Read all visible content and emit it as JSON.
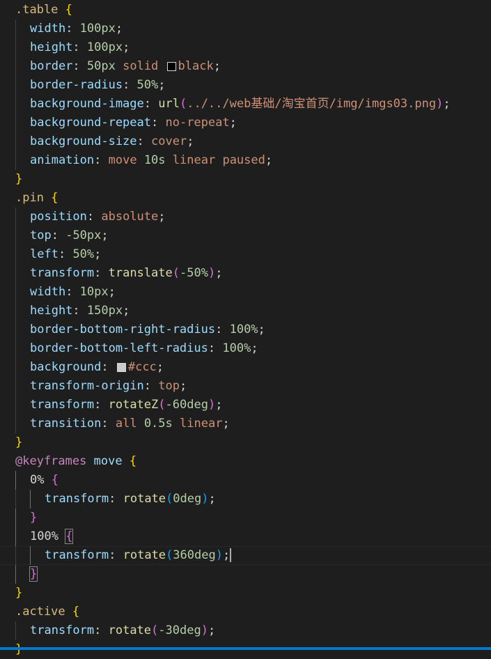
{
  "lines": [
    {
      "indent": 0,
      "tokens": [
        {
          "t": ".table",
          "c": "sel"
        },
        {
          "t": " "
        },
        {
          "t": "{",
          "c": "b1"
        }
      ]
    },
    {
      "indent": 1,
      "tokens": [
        {
          "t": "width",
          "c": "prop"
        },
        {
          "t": ": "
        },
        {
          "t": "100px",
          "c": "num"
        },
        {
          "t": ";"
        }
      ]
    },
    {
      "indent": 1,
      "tokens": [
        {
          "t": "height",
          "c": "prop"
        },
        {
          "t": ": "
        },
        {
          "t": "100px",
          "c": "num"
        },
        {
          "t": ";"
        }
      ]
    },
    {
      "indent": 1,
      "tokens": [
        {
          "t": "border",
          "c": "prop"
        },
        {
          "t": ": "
        },
        {
          "t": "50px",
          "c": "num"
        },
        {
          "t": " "
        },
        {
          "t": "solid",
          "c": "val"
        },
        {
          "t": " "
        },
        {
          "swatch": "#000000"
        },
        {
          "t": "black",
          "c": "val"
        },
        {
          "t": ";"
        }
      ]
    },
    {
      "indent": 1,
      "tokens": [
        {
          "t": "border-radius",
          "c": "prop"
        },
        {
          "t": ": "
        },
        {
          "t": "50%",
          "c": "num"
        },
        {
          "t": ";"
        }
      ]
    },
    {
      "indent": 1,
      "tokens": [
        {
          "t": "background-image",
          "c": "prop"
        },
        {
          "t": ": "
        },
        {
          "t": "url",
          "c": "fn"
        },
        {
          "t": "(",
          "c": "b2"
        },
        {
          "t": "../../web基础/淘宝首页/img/imgs03.png",
          "c": "val"
        },
        {
          "t": ")",
          "c": "b2"
        },
        {
          "t": ";"
        }
      ]
    },
    {
      "indent": 1,
      "tokens": [
        {
          "t": "background-repeat",
          "c": "prop"
        },
        {
          "t": ": "
        },
        {
          "t": "no-repeat",
          "c": "val"
        },
        {
          "t": ";"
        }
      ]
    },
    {
      "indent": 1,
      "tokens": [
        {
          "t": "background-size",
          "c": "prop"
        },
        {
          "t": ": "
        },
        {
          "t": "cover",
          "c": "val"
        },
        {
          "t": ";"
        }
      ]
    },
    {
      "indent": 1,
      "tokens": [
        {
          "t": "animation",
          "c": "prop"
        },
        {
          "t": ": "
        },
        {
          "t": "move",
          "c": "val"
        },
        {
          "t": " "
        },
        {
          "t": "10s",
          "c": "num"
        },
        {
          "t": " "
        },
        {
          "t": "linear",
          "c": "val"
        },
        {
          "t": " "
        },
        {
          "t": "paused",
          "c": "val"
        },
        {
          "t": ";"
        }
      ]
    },
    {
      "indent": 0,
      "tokens": [
        {
          "t": "}",
          "c": "b1"
        }
      ]
    },
    {
      "indent": 0,
      "tokens": [
        {
          "t": ".pin",
          "c": "sel"
        },
        {
          "t": " "
        },
        {
          "t": "{",
          "c": "b1"
        }
      ]
    },
    {
      "indent": 1,
      "tokens": [
        {
          "t": "position",
          "c": "prop"
        },
        {
          "t": ": "
        },
        {
          "t": "absolute",
          "c": "val"
        },
        {
          "t": ";"
        }
      ]
    },
    {
      "indent": 1,
      "tokens": [
        {
          "t": "top",
          "c": "prop"
        },
        {
          "t": ": "
        },
        {
          "t": "-50px",
          "c": "num"
        },
        {
          "t": ";"
        }
      ]
    },
    {
      "indent": 1,
      "tokens": [
        {
          "t": "left",
          "c": "prop"
        },
        {
          "t": ": "
        },
        {
          "t": "50%",
          "c": "num"
        },
        {
          "t": ";"
        }
      ]
    },
    {
      "indent": 1,
      "tokens": [
        {
          "t": "transform",
          "c": "prop"
        },
        {
          "t": ": "
        },
        {
          "t": "translate",
          "c": "fn"
        },
        {
          "t": "(",
          "c": "b2"
        },
        {
          "t": "-50%",
          "c": "num"
        },
        {
          "t": ")",
          "c": "b2"
        },
        {
          "t": ";"
        }
      ]
    },
    {
      "indent": 1,
      "tokens": [
        {
          "t": "width",
          "c": "prop"
        },
        {
          "t": ": "
        },
        {
          "t": "10px",
          "c": "num"
        },
        {
          "t": ";"
        }
      ]
    },
    {
      "indent": 1,
      "tokens": [
        {
          "t": "height",
          "c": "prop"
        },
        {
          "t": ": "
        },
        {
          "t": "150px",
          "c": "num"
        },
        {
          "t": ";"
        }
      ]
    },
    {
      "indent": 1,
      "tokens": [
        {
          "t": "border-bottom-right-radius",
          "c": "prop"
        },
        {
          "t": ": "
        },
        {
          "t": "100%",
          "c": "num"
        },
        {
          "t": ";"
        }
      ]
    },
    {
      "indent": 1,
      "tokens": [
        {
          "t": "border-bottom-left-radius",
          "c": "prop"
        },
        {
          "t": ": "
        },
        {
          "t": "100%",
          "c": "num"
        },
        {
          "t": ";"
        }
      ]
    },
    {
      "indent": 1,
      "tokens": [
        {
          "t": "background",
          "c": "prop"
        },
        {
          "t": ": "
        },
        {
          "swatch": "#cccccc"
        },
        {
          "t": "#ccc",
          "c": "val"
        },
        {
          "t": ";"
        }
      ]
    },
    {
      "indent": 1,
      "tokens": [
        {
          "t": "transform-origin",
          "c": "prop"
        },
        {
          "t": ": "
        },
        {
          "t": "top",
          "c": "val"
        },
        {
          "t": ";"
        }
      ]
    },
    {
      "indent": 1,
      "tokens": [
        {
          "t": "transform",
          "c": "prop"
        },
        {
          "t": ": "
        },
        {
          "t": "rotateZ",
          "c": "fn"
        },
        {
          "t": "(",
          "c": "b2"
        },
        {
          "t": "-60deg",
          "c": "num"
        },
        {
          "t": ")",
          "c": "b2"
        },
        {
          "t": ";"
        }
      ]
    },
    {
      "indent": 1,
      "tokens": [
        {
          "t": "transition",
          "c": "prop"
        },
        {
          "t": ": "
        },
        {
          "t": "all",
          "c": "val"
        },
        {
          "t": " "
        },
        {
          "t": "0.5s",
          "c": "num"
        },
        {
          "t": " "
        },
        {
          "t": "linear",
          "c": "val"
        },
        {
          "t": ";"
        }
      ]
    },
    {
      "indent": 0,
      "tokens": [
        {
          "t": "}",
          "c": "b1"
        }
      ]
    },
    {
      "indent": 0,
      "tokens": [
        {
          "t": "@keyframes",
          "c": "at"
        },
        {
          "t": " "
        },
        {
          "t": "move",
          "c": "prop"
        },
        {
          "t": " "
        },
        {
          "t": "{",
          "c": "b1"
        }
      ]
    },
    {
      "indent": 1,
      "tokens": [
        {
          "t": "0%",
          "c": "punc"
        },
        {
          "t": " "
        },
        {
          "t": "{",
          "c": "b2"
        }
      ]
    },
    {
      "indent": 2,
      "tokens": [
        {
          "t": "transform",
          "c": "prop"
        },
        {
          "t": ": "
        },
        {
          "t": "rotate",
          "c": "fn"
        },
        {
          "t": "(",
          "c": "b3"
        },
        {
          "t": "0deg",
          "c": "num"
        },
        {
          "t": ")",
          "c": "b3"
        },
        {
          "t": ";"
        }
      ]
    },
    {
      "indent": 1,
      "tokens": [
        {
          "t": "}",
          "c": "b2"
        }
      ]
    },
    {
      "indent": 1,
      "tokens": [
        {
          "t": "100%",
          "c": "punc"
        },
        {
          "t": " "
        },
        {
          "t": "{",
          "c": "b2",
          "box": true
        }
      ]
    },
    {
      "indent": 2,
      "current": true,
      "tokens": [
        {
          "t": "transform",
          "c": "prop"
        },
        {
          "t": ": "
        },
        {
          "t": "rotate",
          "c": "fn"
        },
        {
          "t": "(",
          "c": "b3"
        },
        {
          "t": "360deg",
          "c": "num"
        },
        {
          "t": ")",
          "c": "b3"
        },
        {
          "t": ";"
        },
        {
          "caret": true
        }
      ]
    },
    {
      "indent": 1,
      "tokens": [
        {
          "t": "}",
          "c": "b2",
          "box": true
        }
      ]
    },
    {
      "indent": 0,
      "tokens": [
        {
          "t": "}",
          "c": "b1"
        }
      ]
    },
    {
      "indent": 0,
      "tokens": [
        {
          "t": ".active",
          "c": "sel"
        },
        {
          "t": " "
        },
        {
          "t": "{",
          "c": "b1"
        }
      ]
    },
    {
      "indent": 1,
      "tokens": [
        {
          "t": "transform",
          "c": "prop"
        },
        {
          "t": ": "
        },
        {
          "t": "rotate",
          "c": "fn"
        },
        {
          "t": "(",
          "c": "b2"
        },
        {
          "t": "-30deg",
          "c": "num"
        },
        {
          "t": ")",
          "c": "b2"
        },
        {
          "t": ";"
        }
      ]
    },
    {
      "indent": 0,
      "tokens": [
        {
          "t": "}",
          "c": "b1"
        }
      ]
    }
  ],
  "colors": {
    "background": "#1e1e1e",
    "status_bar": "#007acc"
  }
}
